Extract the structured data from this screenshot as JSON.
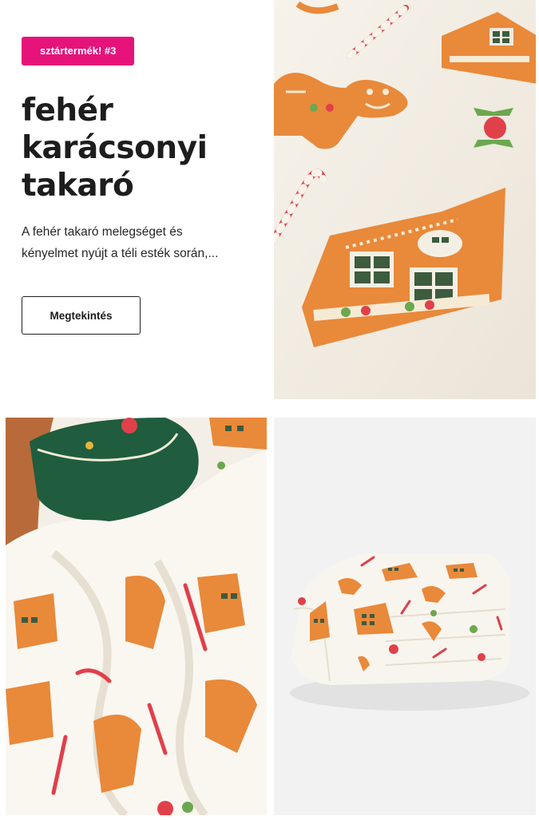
{
  "product": {
    "badge": "sztártermék! #3",
    "title_lines": [
      "fehér",
      "karácsonyi",
      "takaró"
    ],
    "description_line1": "A fehér takaró melegséget és",
    "description_line2": "kényelmet nyújt a téli esték során,...",
    "view_button": "Megtekintés"
  },
  "colors": {
    "badge_bg": "#e5137a",
    "gingerbread": "#e9893a",
    "candy_red": "#e0404a",
    "green": "#1f5d3e"
  },
  "images": {
    "main": "gingerbread-pattern-blanket-closeup",
    "lifestyle": "blanket-with-green-pillow",
    "folded": "folded-blanket-product-shot"
  }
}
